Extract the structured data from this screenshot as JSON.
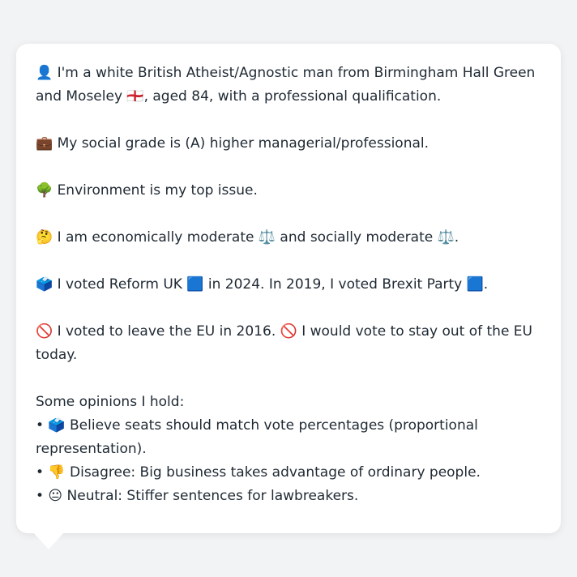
{
  "profile": {
    "identity": "👤 I'm a white British Atheist/Agnostic man from Birmingham Hall Green and Moseley 🏴󠁧󠁢󠁥󠁮󠁧󠁿, aged 84, with a professional qualification.",
    "social_grade": "💼 My social grade is (A) higher managerial/professional.",
    "top_issue": "🌳 Environment is my top issue.",
    "ideology": "🤔 I am economically moderate ⚖️ and socially moderate ⚖️.",
    "votes": "🗳️ I voted Reform UK 🟦 in 2024. In 2019, I voted Brexit Party 🟦.",
    "eu": "🚫 I voted to leave the EU in 2016. 🚫 I would vote to stay out of the EU today."
  },
  "opinions": {
    "heading": "Some opinions I hold:",
    "items": [
      "• 🗳️ Believe seats should match vote percentages (proportional representation).",
      "• 👎 Disagree: Big business takes advantage of ordinary people.",
      "• 😐 Neutral: Stiffer sentences for lawbreakers."
    ]
  }
}
